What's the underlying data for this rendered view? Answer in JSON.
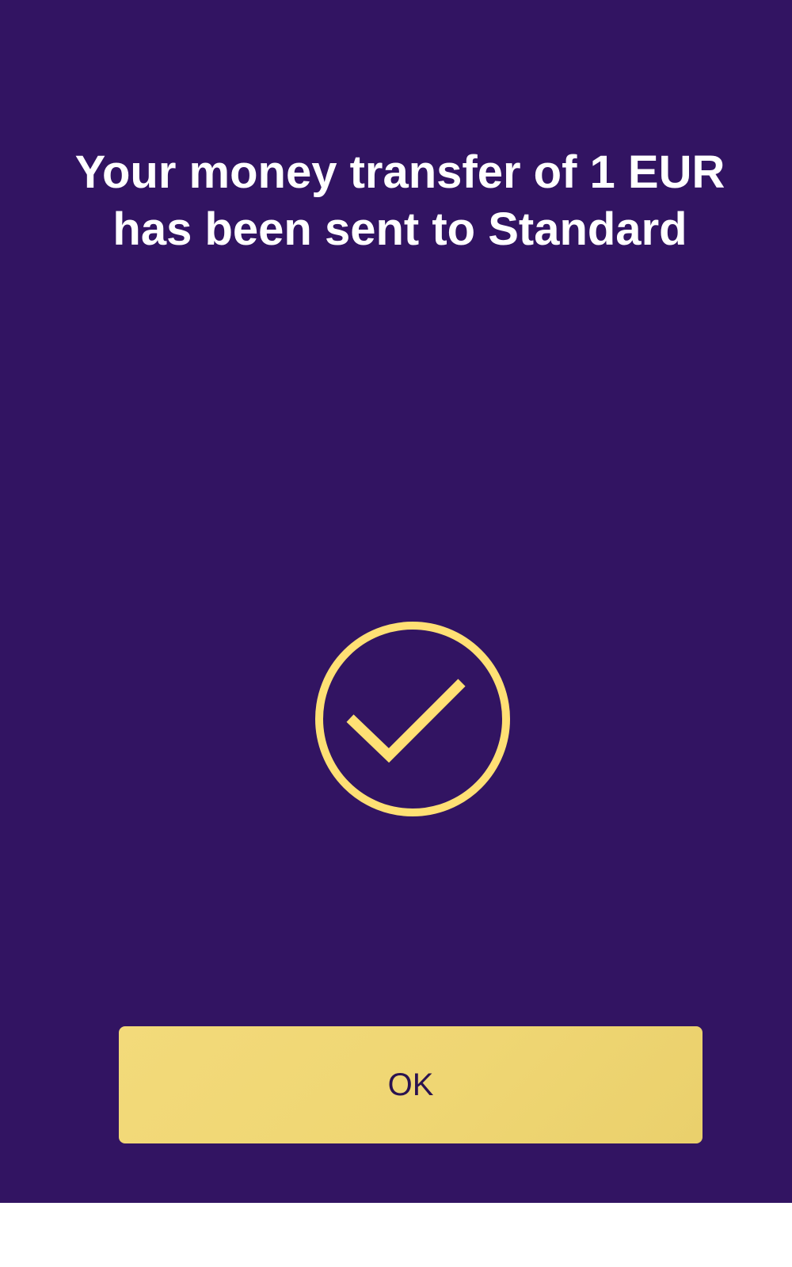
{
  "confirmation": {
    "message_line1": "Your money transfer of 1 EUR",
    "message_line2": "has been sent to Standard"
  },
  "icon": {
    "name": "checkmark-circle-icon"
  },
  "actions": {
    "ok_label": "OK"
  },
  "colors": {
    "background": "#321462",
    "accent": "#FFE074",
    "button": "#F0D674",
    "button_text": "#2B1350",
    "message_text": "#FFFFFF"
  }
}
